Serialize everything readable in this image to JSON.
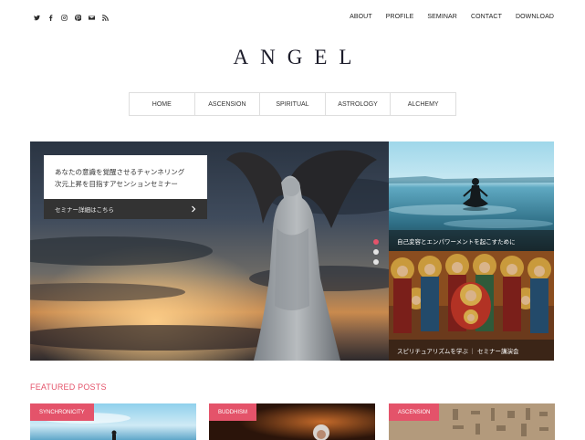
{
  "social": [
    "twitter-icon",
    "facebook-icon",
    "instagram-icon",
    "pinterest-icon",
    "mail-icon",
    "rss-icon"
  ],
  "topnav": [
    "ABOUT",
    "PROFILE",
    "SEMINAR",
    "CONTACT",
    "DOWNLOAD"
  ],
  "logo": "ANGEL",
  "mainnav": [
    "HOME",
    "ASCENSION",
    "SPIRITUAL",
    "ASTROLOGY",
    "ALCHEMY"
  ],
  "hero": {
    "caption_line1": "あなたの意識を覚醒させるチャンネリング",
    "caption_line2": "次元上昇を目指すアセンションセミナー",
    "button_label": "セミナー詳細はこちら",
    "active_slide": 1,
    "slide_count": 3
  },
  "tiles": [
    {
      "label": "自己変容とエンパワーメントを起こすために"
    },
    {
      "label": "スピリチュアリズムを学ぶ ｜ セミナー講演会"
    }
  ],
  "featured": {
    "title": "FEATURED POSTS",
    "cards": [
      {
        "badge": "SYNCHRONICITY"
      },
      {
        "badge": "BUDDHISM"
      },
      {
        "badge": "ASCENSION"
      }
    ]
  },
  "colors": {
    "accent": "#e4536a",
    "dark": "#333333"
  }
}
